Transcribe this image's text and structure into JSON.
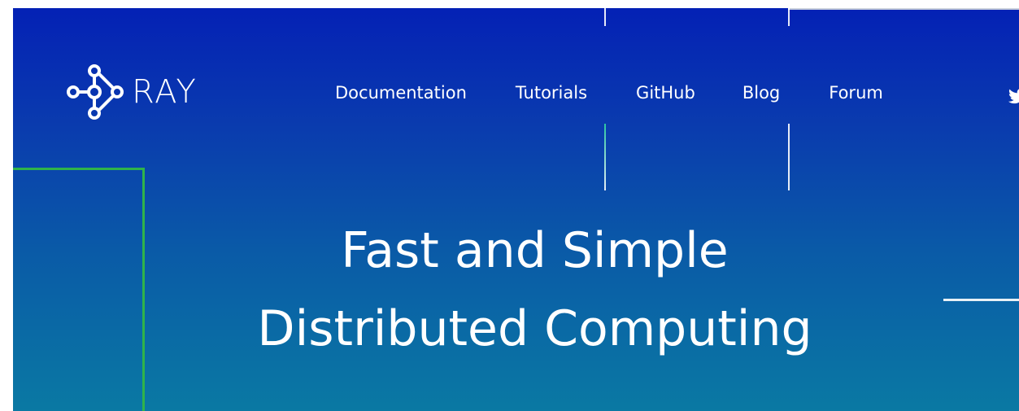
{
  "brand": {
    "name": "RAY",
    "icon": "ray-logo-icon"
  },
  "nav": {
    "items": [
      {
        "label": "Documentation"
      },
      {
        "label": "Tutorials"
      },
      {
        "label": "GitHub"
      },
      {
        "label": "Blog"
      },
      {
        "label": "Forum"
      }
    ],
    "social_icon": "twitter-icon"
  },
  "hero": {
    "title_line1": "Fast and Simple",
    "title_line2": "Distributed Computing"
  },
  "colors": {
    "gradient_top": "#0421b5",
    "gradient_bottom": "#0a79a3",
    "accent_green": "#2fb34a",
    "text": "#ffffff"
  }
}
